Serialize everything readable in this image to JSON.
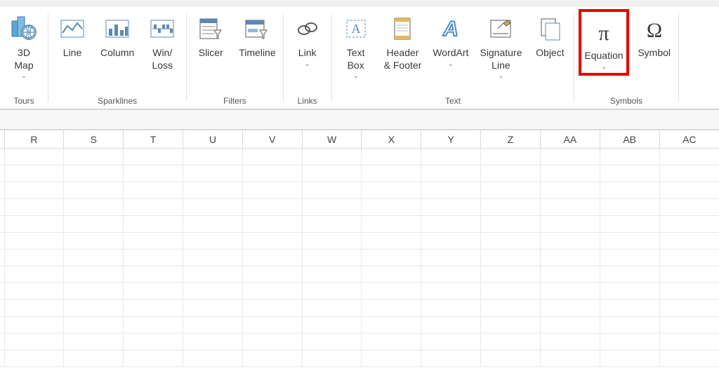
{
  "ribbon": {
    "groups": {
      "tours": {
        "label": "Tours",
        "map3d": "3D\nMap"
      },
      "sparklines": {
        "label": "Sparklines",
        "line": "Line",
        "column": "Column",
        "winloss": "Win/\nLoss"
      },
      "filters": {
        "label": "Filters",
        "slicer": "Slicer",
        "timeline": "Timeline"
      },
      "links": {
        "label": "Links",
        "link": "Link"
      },
      "text": {
        "label": "Text",
        "textbox": "Text\nBox",
        "headerfooter": "Header\n& Footer",
        "wordart": "WordArt",
        "signature": "Signature\nLine",
        "object": "Object"
      },
      "symbols": {
        "label": "Symbols",
        "equation": "Equation",
        "symbol": "Symbol"
      }
    }
  },
  "grid": {
    "columns": [
      "R",
      "S",
      "T",
      "U",
      "V",
      "W",
      "X",
      "Y",
      "Z",
      "AA",
      "AB",
      "AC"
    ],
    "row_count": 13
  }
}
